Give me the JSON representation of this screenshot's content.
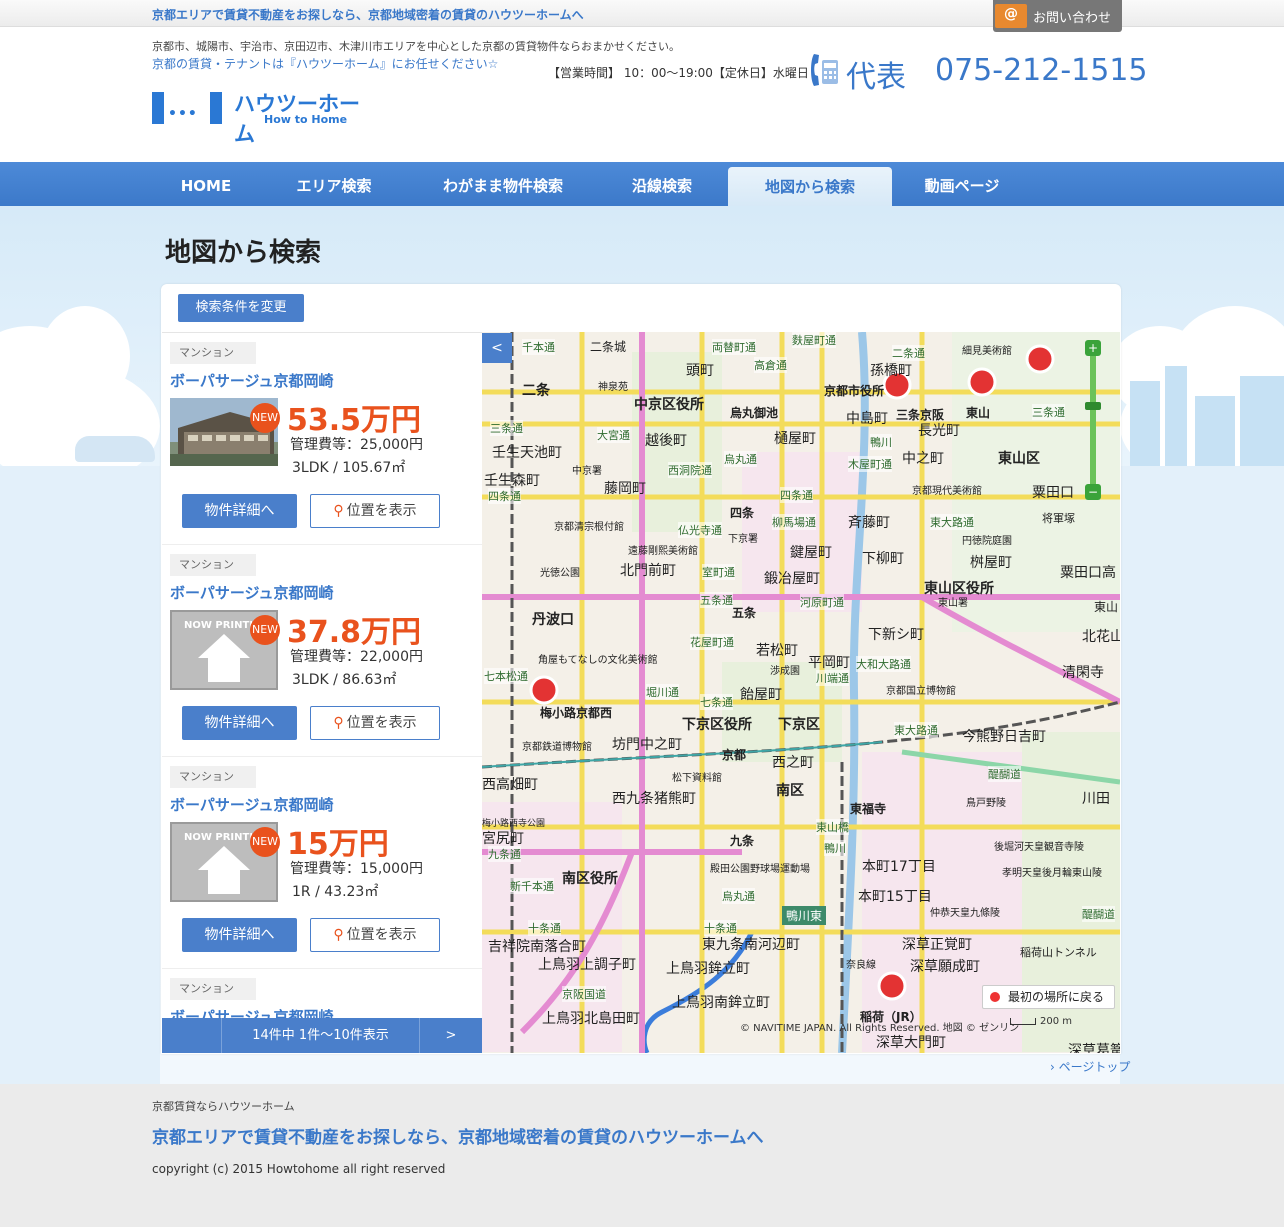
{
  "topbar": {
    "tagline": "京都エリアで賃貸不動産をお探しなら、京都地域密着の賃貸のハウツーホームへ",
    "contact_label": "お問い合わせ"
  },
  "header": {
    "desc1": "京都市、城陽市、宇治市、京田辺市、木津川市エリアを中心とした京都の賃貸物件ならおまかせください。",
    "desc2": "京都の賃貸・テナントは『ハウツーホーム』にお任せください☆",
    "logo_dots": "•••",
    "logo_name": "ハウツーホーム",
    "logo_sub": "How to Home",
    "hours": "【営業時間】 10：00〜19:00【定休日】水曜日",
    "phone_label": "代表",
    "phone_number": "075-212-1515"
  },
  "nav": [
    {
      "label": "HOME"
    },
    {
      "label": "エリア検索"
    },
    {
      "label": "わがまま物件検索"
    },
    {
      "label": "沿線検索"
    },
    {
      "label": "地図から検索"
    },
    {
      "label": "動画ページ"
    }
  ],
  "page": {
    "title": "地図から検索",
    "change_button": "検索条件を変更"
  },
  "listings": [
    {
      "type": "マンション",
      "name": "ボーパサージュ京都岡崎",
      "badge": "NEW",
      "price": "53.5万円",
      "fee": "管理費等：25,000円",
      "spec": "3LDK  / 105.67㎡",
      "detail_label": "物件詳細へ",
      "location_label": "位置を表示",
      "photo": "building"
    },
    {
      "type": "マンション",
      "name": "ボーパサージュ京都岡崎",
      "badge": "NEW",
      "price": "37.8万円",
      "fee": "管理費等：22,000円",
      "spec": "3LDK  / 86.63㎡",
      "detail_label": "物件詳細へ",
      "location_label": "位置を表示",
      "photo": "now-printing",
      "photo_text": "NOW PRINTING"
    },
    {
      "type": "マンション",
      "name": "ボーパサージュ京都岡崎",
      "badge": "NEW",
      "price": "15万円",
      "fee": "管理費等：15,000円",
      "spec": "1R  / 43.23㎡",
      "detail_label": "物件詳細へ",
      "location_label": "位置を表示",
      "photo": "now-printing",
      "photo_text": "NOW PRINTING"
    },
    {
      "type": "マンション",
      "name": "ボーパサージュ京都岡崎"
    }
  ],
  "pager": {
    "info": "14件中 1件〜10件表示",
    "next": ">"
  },
  "map": {
    "toggle": "<",
    "labels": [
      {
        "text": "千本通"
      },
      {
        "text": "二条城"
      },
      {
        "text": "両替町通"
      },
      {
        "text": "高倉通"
      },
      {
        "text": "麩屋町通"
      },
      {
        "text": "二条通"
      },
      {
        "text": "細見美術館"
      },
      {
        "text": "二条"
      },
      {
        "text": "神泉苑"
      },
      {
        "text": "中京区役所"
      },
      {
        "text": "頭町"
      },
      {
        "text": "京都市役所"
      },
      {
        "text": "孫橋町"
      },
      {
        "text": "三条通"
      },
      {
        "text": "烏丸御池"
      },
      {
        "text": "中島町"
      },
      {
        "text": "三条京阪"
      },
      {
        "text": "東山"
      },
      {
        "text": "三条通"
      },
      {
        "text": "壬生天池町"
      },
      {
        "text": "大宮通"
      },
      {
        "text": "越後町"
      },
      {
        "text": "樋屋町"
      },
      {
        "text": "長光町"
      },
      {
        "text": "鴨川"
      },
      {
        "text": "中京署"
      },
      {
        "text": "西洞院通"
      },
      {
        "text": "烏丸通"
      },
      {
        "text": "木屋町通"
      },
      {
        "text": "中之町"
      },
      {
        "text": "東山区"
      },
      {
        "text": "壬生森町"
      },
      {
        "text": "藤岡町"
      },
      {
        "text": "京都現代美術館"
      },
      {
        "text": "粟田口"
      },
      {
        "text": "四条通"
      },
      {
        "text": "四条通"
      },
      {
        "text": "京都清宗根付館"
      },
      {
        "text": "四条"
      },
      {
        "text": "柳馬場通"
      },
      {
        "text": "斉藤町"
      },
      {
        "text": "東大路通"
      },
      {
        "text": "将軍塚"
      },
      {
        "text": "仏光寺通"
      },
      {
        "text": "下京署"
      },
      {
        "text": "円徳院庭園"
      },
      {
        "text": "遠藤剛熙美術館"
      },
      {
        "text": "鍵屋町"
      },
      {
        "text": "下柳町"
      },
      {
        "text": "桝屋町"
      },
      {
        "text": "光徳公園"
      },
      {
        "text": "北門前町"
      },
      {
        "text": "室町通"
      },
      {
        "text": "鍛冶屋町"
      },
      {
        "text": "粟田口高"
      },
      {
        "text": "東山区役所"
      },
      {
        "text": "五条通"
      },
      {
        "text": "河原町通"
      },
      {
        "text": "東山署"
      },
      {
        "text": "丹波口"
      },
      {
        "text": "五条"
      },
      {
        "text": "東山"
      },
      {
        "text": "花屋町通"
      },
      {
        "text": "下新シ町"
      },
      {
        "text": "北花山"
      },
      {
        "text": "角屋もてなしの文化美術館"
      },
      {
        "text": "若松町"
      },
      {
        "text": "平岡町"
      },
      {
        "text": "大和大路通"
      },
      {
        "text": "七本松通"
      },
      {
        "text": "渉成園"
      },
      {
        "text": "川端通"
      },
      {
        "text": "清閑寺"
      },
      {
        "text": "堀川通"
      },
      {
        "text": "飴屋町"
      },
      {
        "text": "京都国立博物館"
      },
      {
        "text": "七条通"
      },
      {
        "text": "梅小路京都西"
      },
      {
        "text": "下京区役所"
      },
      {
        "text": "下京区"
      },
      {
        "text": "東大路通"
      },
      {
        "text": "今熊野日吉町"
      },
      {
        "text": "京都鉄道博物館"
      },
      {
        "text": "坊門中之町"
      },
      {
        "text": "京都"
      },
      {
        "text": "西之町"
      },
      {
        "text": "醍醐道"
      },
      {
        "text": "松下資料館"
      },
      {
        "text": "西高畑町"
      },
      {
        "text": "西九条猪熊町"
      },
      {
        "text": "南区"
      },
      {
        "text": "鳥戸野陵"
      },
      {
        "text": "川田"
      },
      {
        "text": "東福寺"
      },
      {
        "text": "梅小路西寺公園"
      },
      {
        "text": "九条"
      },
      {
        "text": "東山橋"
      },
      {
        "text": "後堀河天皇観音寺陵"
      },
      {
        "text": "宮尻町"
      },
      {
        "text": "鴨川"
      },
      {
        "text": "九条通"
      },
      {
        "text": "殿田公園野球場運動場"
      },
      {
        "text": "本町17丁目"
      },
      {
        "text": "孝明天皇後月輪東山陵"
      },
      {
        "text": "南区役所"
      },
      {
        "text": "新千本通"
      },
      {
        "text": "烏丸通"
      },
      {
        "text": "本町15丁目"
      },
      {
        "text": "仲恭天皇九條陵"
      },
      {
        "text": "醍醐道"
      },
      {
        "text": "鴨川東"
      },
      {
        "text": "十条通"
      },
      {
        "text": "十条通"
      },
      {
        "text": "深草正覚町"
      },
      {
        "text": "吉祥院南落合町"
      },
      {
        "text": "東九条南河辺町"
      },
      {
        "text": "稲荷山トンネル"
      },
      {
        "text": "上鳥羽上調子町"
      },
      {
        "text": "上鳥羽鉾立町"
      },
      {
        "text": "奈良線"
      },
      {
        "text": "深草願成町"
      },
      {
        "text": "京阪国道"
      },
      {
        "text": "上鳥羽南鉾立町"
      },
      {
        "text": "上鳥羽北島田町"
      },
      {
        "text": "稲荷（JR）"
      },
      {
        "text": "深草大門町"
      },
      {
        "text": "深草葛篭"
      }
    ],
    "return_label": "最初の場所に戻る",
    "copyright": "© NAVITIME JAPAN. All Rights Reserved. 地図 © ゼンリン",
    "scale": "200 m"
  },
  "pagetop": "ページトップ",
  "footer": {
    "small": "京都賃貸ならハウツーホーム",
    "big": "京都エリアで賃貸不動産をお探しなら、京都地域密着の賃貸のハウツーホームへ",
    "copyright": "copyright (c) 2015 Howtohome all right reserved"
  },
  "colors": {
    "accent": "#3a78c9",
    "price": "#e9521d",
    "nav": "#4a7fcb",
    "marker": "#e33333"
  }
}
